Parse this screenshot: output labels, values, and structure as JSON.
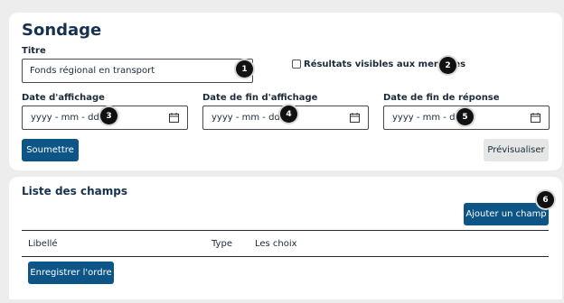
{
  "survey": {
    "title": "Sondage",
    "title_field": {
      "label": "Titre",
      "value": "Fonds régional en transport"
    },
    "results_visible": {
      "label": "Résultats visibles aux membres",
      "checked": false
    },
    "display_date": {
      "label": "Date d'affichage",
      "placeholder": "yyyy - mm - dd"
    },
    "end_display_date": {
      "label": "Date de fin d'affichage",
      "placeholder": "yyyy - mm - dd"
    },
    "response_end_date": {
      "label": "Date de fin de réponse",
      "placeholder": "yyyy - mm - dd"
    },
    "submit_label": "Soumettre",
    "preview_label": "Prévisualiser"
  },
  "fields": {
    "title": "Liste des champs",
    "add_field_label": "Ajouter un champ",
    "columns": [
      "Libellé",
      "Type",
      "Les choix"
    ],
    "save_order_label": "Enregistrer l'ordre"
  },
  "annotations": [
    "1",
    "2",
    "3",
    "4",
    "5",
    "6"
  ],
  "colors": {
    "primary": "#0d5487",
    "heading": "#16324f",
    "secondary_button": "#e5e6e6",
    "background": "#ededed",
    "badge": "#111111"
  }
}
